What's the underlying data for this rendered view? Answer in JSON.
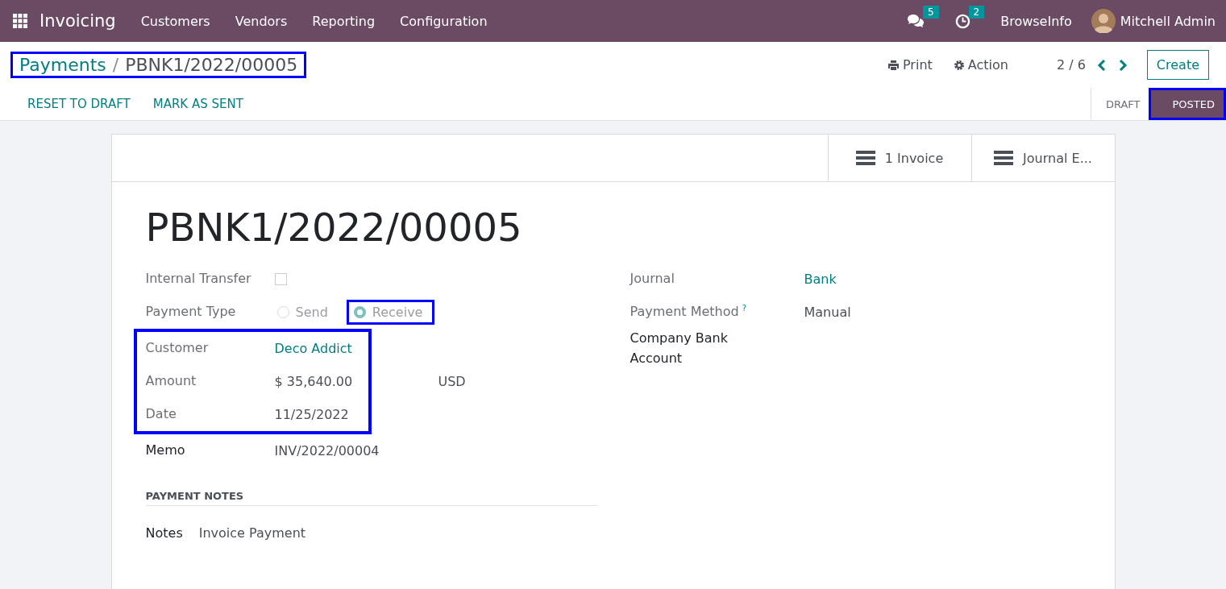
{
  "navbar": {
    "app_title": "Invoicing",
    "menu": [
      "Customers",
      "Vendors",
      "Reporting",
      "Configuration"
    ],
    "messages_count": "5",
    "activities_count": "2",
    "company": "BrowseInfo",
    "user": "Mitchell Admin"
  },
  "breadcrumb": {
    "parent": "Payments",
    "separator": "/",
    "current": "PBNK1/2022/00005",
    "highlighted": true
  },
  "toolbar": {
    "print": "Print",
    "action": "Action",
    "pager": "2 / 6",
    "create": "Create"
  },
  "actions": [
    "RESET TO DRAFT",
    "MARK AS SENT"
  ],
  "statusbar": [
    {
      "label": "DRAFT",
      "selected": false,
      "highlighted": false
    },
    {
      "label": "POSTED",
      "selected": true,
      "highlighted": true
    }
  ],
  "smart_buttons": [
    "1 Invoice",
    "Journal E..."
  ],
  "record": {
    "title": "PBNK1/2022/00005",
    "left_fields": [
      {
        "kind": "checkbox",
        "label": "Internal Transfer",
        "readonly": true,
        "checked": false
      },
      {
        "kind": "radio",
        "label": "Payment Type",
        "readonly": true,
        "options": [
          {
            "label": "Send",
            "selected": false,
            "highlighted": false
          },
          {
            "label": "Receive",
            "selected": true,
            "highlighted": true
          }
        ]
      },
      {
        "kind": "group",
        "highlighted": true,
        "fields": [
          {
            "kind": "link",
            "label": "Customer",
            "value": "Deco Addict",
            "readonly": true
          },
          {
            "kind": "amount",
            "label": "Amount",
            "value": "$ 35,640.00",
            "currency": "USD",
            "readonly": true
          },
          {
            "kind": "text",
            "label": "Date",
            "value": "11/25/2022",
            "readonly": true
          }
        ]
      },
      {
        "kind": "text",
        "label": "Memo",
        "value": "INV/2022/00004",
        "readonly": false
      }
    ],
    "right_fields": [
      {
        "kind": "link",
        "label": "Journal",
        "value": "Bank",
        "readonly": true
      },
      {
        "kind": "text",
        "label": "Payment Method",
        "help": "?",
        "value": "Manual",
        "readonly": true
      },
      {
        "kind": "empty",
        "label": "Company Bank Account",
        "readonly": false
      }
    ],
    "notes_heading": "PAYMENT NOTES",
    "notes": {
      "label": "Notes",
      "value": "Invoice Payment"
    }
  }
}
